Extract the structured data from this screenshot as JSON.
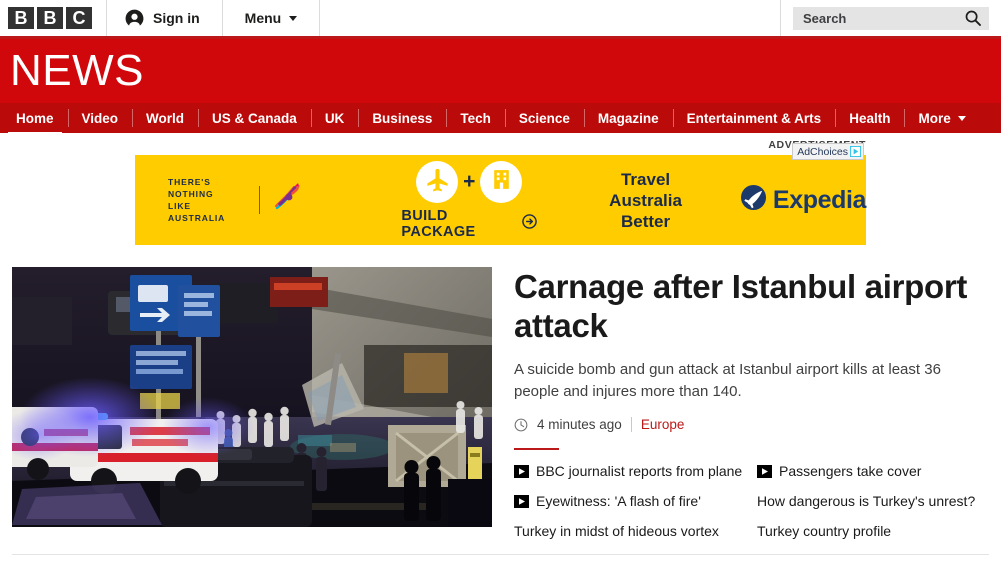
{
  "topbar": {
    "logo_letters": [
      "B",
      "B",
      "C"
    ],
    "account_icon": "account-icon",
    "signin_label": "Sign in",
    "menu_label": "Menu",
    "menu_caret_icon": "chevron-down-icon",
    "search": {
      "placeholder": "Search",
      "value": "",
      "icon": "search-icon"
    }
  },
  "masthead": {
    "title": "NEWS",
    "brand_red": "#d0070b",
    "nav_red": "#bb0a0a"
  },
  "nav": {
    "items": [
      {
        "label": "Home",
        "active": true
      },
      {
        "label": "Video",
        "active": false
      },
      {
        "label": "World",
        "active": false
      },
      {
        "label": "US & Canada",
        "active": false
      },
      {
        "label": "UK",
        "active": false
      },
      {
        "label": "Business",
        "active": false
      },
      {
        "label": "Tech",
        "active": false
      },
      {
        "label": "Science",
        "active": false
      },
      {
        "label": "Magazine",
        "active": false
      },
      {
        "label": "Entertainment & Arts",
        "active": false
      },
      {
        "label": "Health",
        "active": false
      },
      {
        "label": "More",
        "active": false,
        "caret": true
      }
    ]
  },
  "advert": {
    "label": "ADVERTISEMENT",
    "adchoices_label": "AdChoices",
    "adchoices_icon": "adchoices-triangle-icon",
    "background_color": "#ffcc00",
    "text_color": "#1b2a4a",
    "australia_line1": "THERE'S NOTHING",
    "australia_line2": "LIKE AUSTRALIA",
    "kangaroo_icon": "kangaroo-logo-icon",
    "plane_icon": "airplane-icon",
    "hotel_icon": "hotel-building-icon",
    "plus_symbol": "+",
    "build_package_label": "BUILD PACKAGE",
    "build_arrow_icon": "arrow-right-circle-icon",
    "tagline_line1": "Travel",
    "tagline_line2": "Australia",
    "tagline_line3": "Better",
    "expedia_label": "Expedia",
    "expedia_icon": "expedia-plane-logo-icon"
  },
  "story": {
    "photo_alt": "Night scene at Istanbul Ataturk airport with ambulances and emergency responders",
    "headline": "Carnage after Istanbul airport attack",
    "summary": "A suicide bomb and gun attack at Istanbul airport kills at least 36 people and injures more than 140.",
    "clock_icon": "clock-icon",
    "timestamp": "4 minutes ago",
    "section": "Europe",
    "section_color": "#bb1919",
    "related_left": [
      {
        "label": "BBC journalist reports from plane",
        "video": true
      },
      {
        "label": "Eyewitness: 'A flash of fire'",
        "video": true
      },
      {
        "label": "Turkey in midst of hideous vortex",
        "video": false
      }
    ],
    "related_right": [
      {
        "label": "Passengers take cover",
        "video": true
      },
      {
        "label": "How dangerous is Turkey's unrest?",
        "video": false
      },
      {
        "label": "Turkey country profile",
        "video": false
      }
    ]
  }
}
